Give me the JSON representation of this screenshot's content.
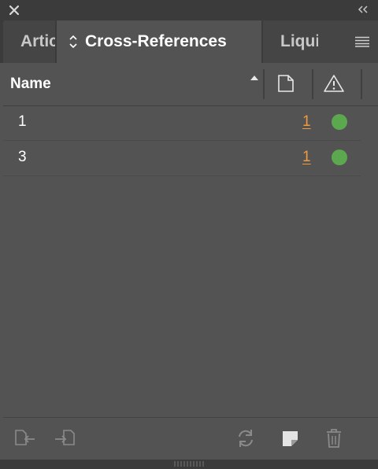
{
  "window": {
    "close_icon": "close-icon",
    "collapse_icon": "double-chevron-left-icon"
  },
  "tabs": [
    {
      "label": "Articles",
      "active": false
    },
    {
      "label": "Cross-References",
      "active": true
    },
    {
      "label": "Liquid",
      "active": false
    }
  ],
  "header": {
    "name_label": "Name",
    "sort": "ascending",
    "page_icon": "page-icon",
    "warning_icon": "warning-icon"
  },
  "rows": [
    {
      "name": "1",
      "count": "1",
      "status": "ok"
    },
    {
      "name": "3",
      "count": "1",
      "status": "ok"
    }
  ],
  "colors": {
    "status_ok": "#5ca84e",
    "link": "#f09a3e",
    "panel_bg": "#535353",
    "chrome_bg": "#3b3b3b"
  },
  "footer": {
    "buttons": [
      {
        "icon": "relink-source-icon"
      },
      {
        "icon": "place-destination-icon"
      },
      {
        "icon": "update-refresh-icon"
      },
      {
        "icon": "new-cross-reference-icon"
      },
      {
        "icon": "trash-icon"
      }
    ]
  }
}
